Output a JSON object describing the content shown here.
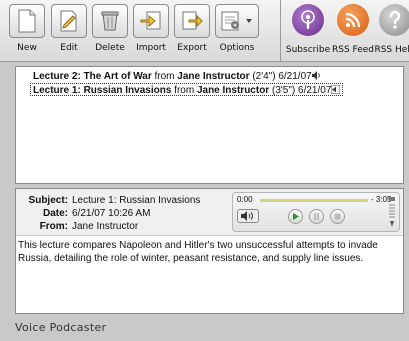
{
  "toolbar": {
    "new_label": "New",
    "edit_label": "Edit",
    "delete_label": "Delete",
    "import_label": "Import",
    "export_label": "Export",
    "options_label": "Options",
    "subscribe_label": "Subscribe",
    "rss_label": "RSS Feed",
    "help_label": "RSS Help"
  },
  "lectures": [
    {
      "title": "Lecture 2: The Art of War",
      "from_word": "from",
      "author": "Jane Instructor",
      "duration": "(2'4\")",
      "date": "6/21/07",
      "selected": false
    },
    {
      "title": "Lecture 1: Russian Invasions",
      "from_word": "from",
      "author": "Jane Instructor",
      "duration": "(3'5\")",
      "date": "6/21/07",
      "selected": true
    }
  ],
  "detail": {
    "subject_label": "Subject:",
    "subject": "Lecture 1: Russian Invasions",
    "date_label": "Date:",
    "date": "6/21/07 10:26 AM",
    "from_label": "From:",
    "from": "Jane Instructor",
    "description": "This lecture compares Napoleon and Hitler's two unsuccessful attempts to invade Russia, detailing the role of winter, peasant resistance, and supply line issues."
  },
  "player": {
    "elapsed": "0:00",
    "remaining": "- 3:05",
    "progress": 0
  },
  "app": {
    "name": "Voice Podcaster"
  },
  "icons": {
    "new": "new-document-icon",
    "edit": "edit-pencil-icon",
    "delete": "trash-icon",
    "import": "import-icon",
    "export": "export-icon",
    "options": "options-gear-icon",
    "subscribe": "podcast-icon",
    "rss": "rss-icon",
    "help": "help-question-icon",
    "speaker": "speaker-icon"
  },
  "colors": {
    "rss_orange": "#e8742a",
    "subscribe_purple": "#7b3fa0",
    "help_gray": "#8c8c8c",
    "play_green": "#2e8b2e"
  }
}
